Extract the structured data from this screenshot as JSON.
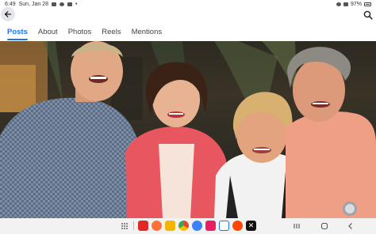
{
  "status_bar": {
    "time": "6:49",
    "date": "Sun, Jan 28",
    "battery": "97%"
  },
  "nav": {
    "back_icon": "arrow-left-icon",
    "search_icon": "search-icon"
  },
  "tabs": [
    {
      "label": "Posts",
      "active": true
    },
    {
      "label": "About",
      "active": false
    },
    {
      "label": "Photos",
      "active": false
    },
    {
      "label": "Reels",
      "active": false
    },
    {
      "label": "Mentions",
      "active": false
    }
  ],
  "colors": {
    "accent": "#1877f2",
    "back_button_bg": "#e4e6eb"
  },
  "dock": {
    "apps": [
      {
        "name": "app-drawer-icon",
        "color": "#666666"
      },
      {
        "name": "flipboard-icon",
        "color": "#e12828"
      },
      {
        "name": "firefox-icon",
        "color": "#ff7139"
      },
      {
        "name": "files-icon",
        "color": "#f4b400"
      },
      {
        "name": "chrome-icon",
        "color": "#4285f4"
      },
      {
        "name": "messages-icon",
        "color": "#3b82f6"
      },
      {
        "name": "screen-recorder-icon",
        "color": "#e91e63"
      },
      {
        "name": "calendar-icon",
        "color": "#1a73e8"
      },
      {
        "name": "reddit-icon",
        "color": "#ff4500"
      },
      {
        "name": "x-icon",
        "color": "#111111"
      }
    ],
    "system_nav": [
      "recents-icon",
      "home-icon",
      "back-icon"
    ]
  }
}
